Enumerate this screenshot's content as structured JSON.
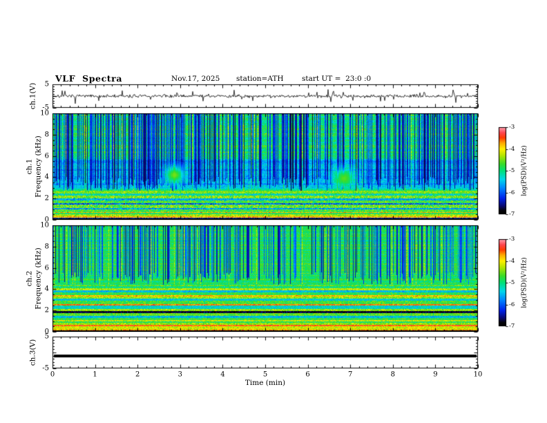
{
  "header": {
    "title": "VLF  Spectra",
    "date": "Nov.17, 2025",
    "station": "station=ATH",
    "start_ut": "start UT =  23:0 :0"
  },
  "xaxis": {
    "label": "Time (min)",
    "ticks": [
      0,
      1,
      2,
      3,
      4,
      5,
      6,
      7,
      8,
      9,
      10
    ],
    "lim": [
      0,
      10
    ],
    "minor_step": 0.2
  },
  "colorbar_label": "log(PSD)(V²/Hz)",
  "accent_colors": {
    "trace": "#000000",
    "frame": "#000000",
    "background": "#ffffff"
  },
  "chart_data": [
    {
      "id": "ch1_waveform",
      "type": "line",
      "ylabel": "ch.1(V)",
      "ylim": [
        -5,
        5
      ],
      "ytick_vals": [
        5,
        -5
      ],
      "ytick_labels": [
        "5",
        "-5"
      ],
      "color": "#000000",
      "signal": {
        "mean": 0,
        "noise_amp": 1.0,
        "spike_rate": 0.05,
        "spike_amp": 2.2,
        "seed": 7
      }
    },
    {
      "id": "ch1_spectrogram",
      "type": "heatmap",
      "ylabel": [
        "ch.1",
        "Frequency (kHz)"
      ],
      "ylim": [
        0,
        10
      ],
      "yticks": [
        10,
        8,
        6,
        4,
        2,
        0
      ],
      "clim": [
        -7,
        -3
      ],
      "colorbar_ticks": [
        "-3",
        "-4",
        "-5",
        "-6",
        "-7"
      ],
      "texture": {
        "seed": 11,
        "background": -4.95,
        "noise": 0.6,
        "row_streak": 0.55,
        "blue_zone": {
          "fmin": 2.9,
          "fmax": 5.7,
          "delta": -0.65
        },
        "stripes": {
          "density": 0.48,
          "fmin": 2.72,
          "fmin_spread": 1.3,
          "value": -6.75
        },
        "bright_columns": {
          "density": 0.05,
          "delta": 0.55
        },
        "bands": [
          [
            0.0,
            0.12,
            -7.0,
            0.1
          ],
          [
            0.12,
            0.22,
            -6.2,
            0.4
          ],
          [
            0.22,
            0.32,
            -3.8,
            0.4
          ],
          [
            0.32,
            0.5,
            -4.3,
            0.5
          ],
          [
            0.5,
            0.62,
            -4.9,
            0.4
          ],
          [
            0.62,
            0.74,
            -3.9,
            0.5
          ],
          [
            0.74,
            0.95,
            -4.7,
            0.5
          ],
          [
            0.95,
            1.1,
            -5.7,
            0.5
          ],
          [
            1.1,
            1.42,
            -4.6,
            0.6
          ],
          [
            1.42,
            1.55,
            -6.0,
            0.5
          ],
          [
            1.55,
            1.85,
            -4.7,
            0.5
          ],
          [
            1.85,
            2.0,
            -5.6,
            0.5
          ],
          [
            2.0,
            2.3,
            -4.5,
            0.6
          ],
          [
            2.3,
            2.5,
            -5.2,
            0.5
          ],
          [
            2.5,
            2.72,
            -4.5,
            0.4
          ]
        ],
        "blobs": [
          {
            "t": 2.87,
            "f": 4.2,
            "dt": 0.22,
            "df": 0.8,
            "v": -4.5
          },
          {
            "t": 6.85,
            "f": 3.9,
            "dt": 0.25,
            "df": 0.9,
            "v": -4.6
          }
        ]
      }
    },
    {
      "id": "ch2_spectrogram",
      "type": "heatmap",
      "ylabel": [
        "ch.2",
        "Frequency (kHz)"
      ],
      "ylim": [
        0,
        10
      ],
      "yticks": [
        10,
        8,
        6,
        4,
        2,
        0
      ],
      "clim": [
        -7,
        -3
      ],
      "colorbar_ticks": [
        "-3",
        "-4",
        "-5",
        "-6",
        "-7"
      ],
      "texture": {
        "seed": 23,
        "background": -4.85,
        "noise": 0.5,
        "row_streak": 0.4,
        "blue_zone": null,
        "stripes": {
          "density": 0.34,
          "fmin": 4.42,
          "fmin_spread": 1.2,
          "value": -6.6
        },
        "bright_columns": {
          "density": 0.03,
          "delta": 0.5
        },
        "bands": [
          [
            0.0,
            0.1,
            -7.0,
            0.1
          ],
          [
            0.1,
            0.2,
            -3.7,
            0.4
          ],
          [
            0.2,
            0.5,
            -4.15,
            0.4
          ],
          [
            0.5,
            0.62,
            -3.5,
            0.3
          ],
          [
            0.62,
            0.82,
            -4.4,
            0.4
          ],
          [
            0.82,
            0.97,
            -4.9,
            0.4
          ],
          [
            0.97,
            1.12,
            -4.2,
            0.4
          ],
          [
            1.12,
            1.32,
            -4.8,
            0.4
          ],
          [
            1.32,
            1.47,
            -5.5,
            0.4
          ],
          [
            1.47,
            1.77,
            -4.6,
            0.4
          ],
          [
            1.77,
            1.95,
            -6.8,
            0.3
          ],
          [
            1.95,
            2.17,
            -4.4,
            0.4
          ],
          [
            2.17,
            2.45,
            -5.3,
            0.4
          ],
          [
            2.45,
            2.6,
            -3.6,
            0.3
          ],
          [
            2.6,
            2.92,
            -4.7,
            0.4
          ],
          [
            2.92,
            3.12,
            -5.4,
            0.4
          ],
          [
            3.12,
            3.32,
            -4.4,
            0.4
          ],
          [
            3.32,
            3.47,
            -3.8,
            0.3
          ],
          [
            3.47,
            3.72,
            -4.8,
            0.4
          ],
          [
            3.72,
            3.92,
            -5.5,
            0.4
          ],
          [
            3.92,
            4.07,
            -4.3,
            0.4
          ],
          [
            4.07,
            4.27,
            -5.0,
            0.4
          ],
          [
            4.27,
            4.42,
            -4.6,
            0.4
          ]
        ],
        "blobs": []
      }
    },
    {
      "id": "ch3_waveform",
      "type": "line",
      "ylabel": "ch.3(V)",
      "ylim": [
        -5,
        5
      ],
      "ytick_vals": [
        5,
        -5
      ],
      "ytick_labels": [
        "5",
        "-5"
      ],
      "color": "#000000",
      "signal": {
        "constant": -1.1,
        "thickness": 4,
        "seed": 1
      }
    }
  ]
}
